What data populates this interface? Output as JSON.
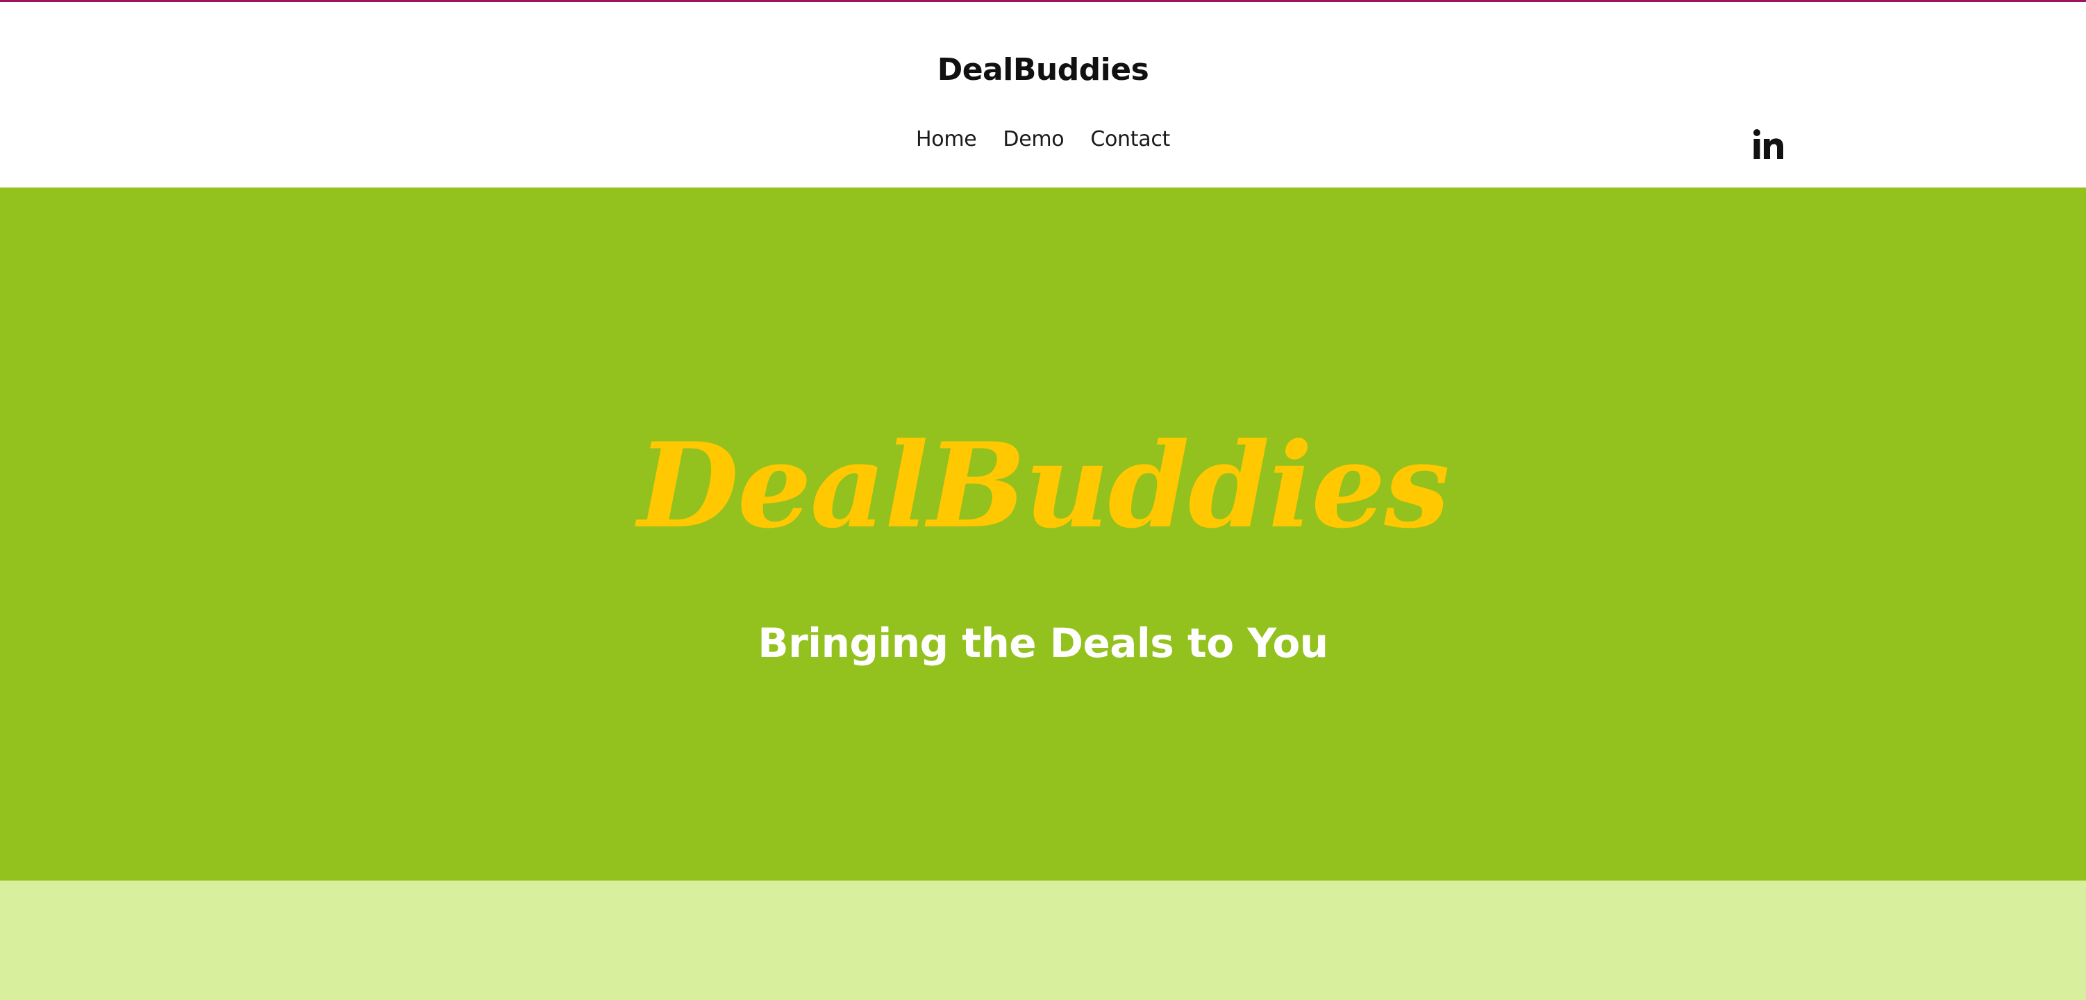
{
  "header": {
    "site_title": "DealBuddies",
    "nav": [
      {
        "label": "Home"
      },
      {
        "label": "Demo"
      },
      {
        "label": "Contact"
      }
    ],
    "social_icon": "linkedin-icon"
  },
  "hero": {
    "title": "DealBuddies",
    "subtitle": "Bringing the Deals to You"
  },
  "colors": {
    "accent_line": "#a0135f",
    "hero_bg": "#93c11e",
    "hero_title": "#ffc800",
    "lower_band": "#d8ef9e"
  }
}
